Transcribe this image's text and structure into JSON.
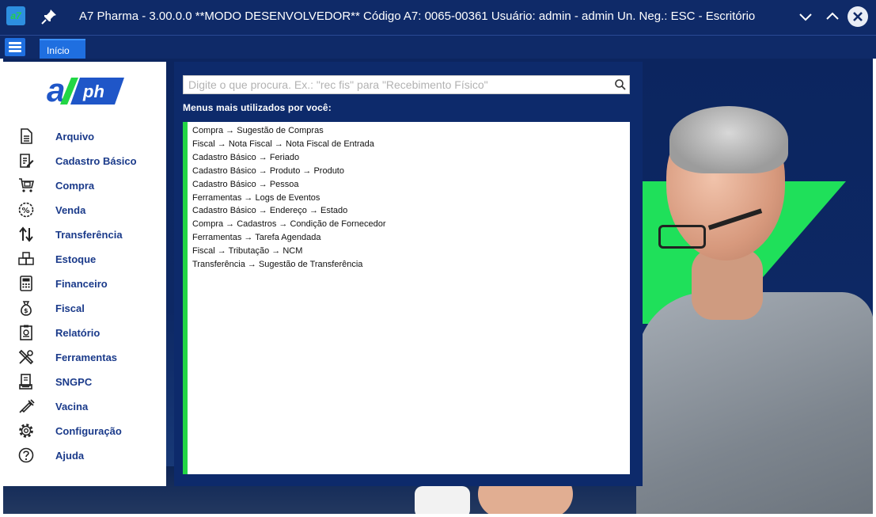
{
  "window": {
    "app_icon_text": "a7",
    "title": "A7 Pharma - 3.00.0.0 **MODO DESENVOLVEDOR** Código A7: 0065-00361 Usuário: admin - admin Un. Neg.: ESC - Escritório"
  },
  "tabs": [
    {
      "label": "Início",
      "active": true
    }
  ],
  "brand": {
    "logo_text": "a7ph",
    "colors": {
      "blue": "#1f56c8",
      "green": "#22d645"
    }
  },
  "sidebar": {
    "items": [
      {
        "label": "Arquivo",
        "icon": "file-icon"
      },
      {
        "label": "Cadastro Básico",
        "icon": "edit-document-icon"
      },
      {
        "label": "Compra",
        "icon": "cart-icon"
      },
      {
        "label": "Venda",
        "icon": "percent-badge-icon"
      },
      {
        "label": "Transferência",
        "icon": "transfer-arrows-icon"
      },
      {
        "label": "Estoque",
        "icon": "boxes-icon"
      },
      {
        "label": "Financeiro",
        "icon": "calculator-icon"
      },
      {
        "label": "Fiscal",
        "icon": "money-bag-icon"
      },
      {
        "label": "Relatório",
        "icon": "report-icon"
      },
      {
        "label": "Ferramentas",
        "icon": "tools-icon"
      },
      {
        "label": "SNGPC",
        "icon": "document-stamp-icon"
      },
      {
        "label": "Vacina",
        "icon": "syringe-icon"
      },
      {
        "label": "Configuração",
        "icon": "gear-icon"
      },
      {
        "label": "Ajuda",
        "icon": "help-icon"
      }
    ]
  },
  "search": {
    "placeholder": "Digite o que procura. Ex.: \"rec fis\" para \"Recebimento Físico\"",
    "value": ""
  },
  "recent": {
    "title": "Menus mais utilizados por você:",
    "items": [
      "Compra → Sugestão de Compras",
      "Fiscal → Nota Fiscal → Nota Fiscal de Entrada",
      "Cadastro Básico → Feriado",
      "Cadastro Básico → Produto → Produto",
      "Cadastro Básico → Pessoa",
      "Ferramentas → Logs de Eventos",
      "Cadastro Básico → Endereço → Estado",
      "Compra → Cadastros → Condição de Fornecedor",
      "Ferramentas → Tarefa Agendada",
      "Fiscal → Tributação → NCM",
      "Transferência → Sugestão de Transferência"
    ]
  },
  "colors": {
    "titlebar": "#0f2a68",
    "panel": "#0d2a6b",
    "accent_green": "#22d645",
    "menu_text": "#1a3a8a",
    "tab_active": "#1f6fe0"
  }
}
